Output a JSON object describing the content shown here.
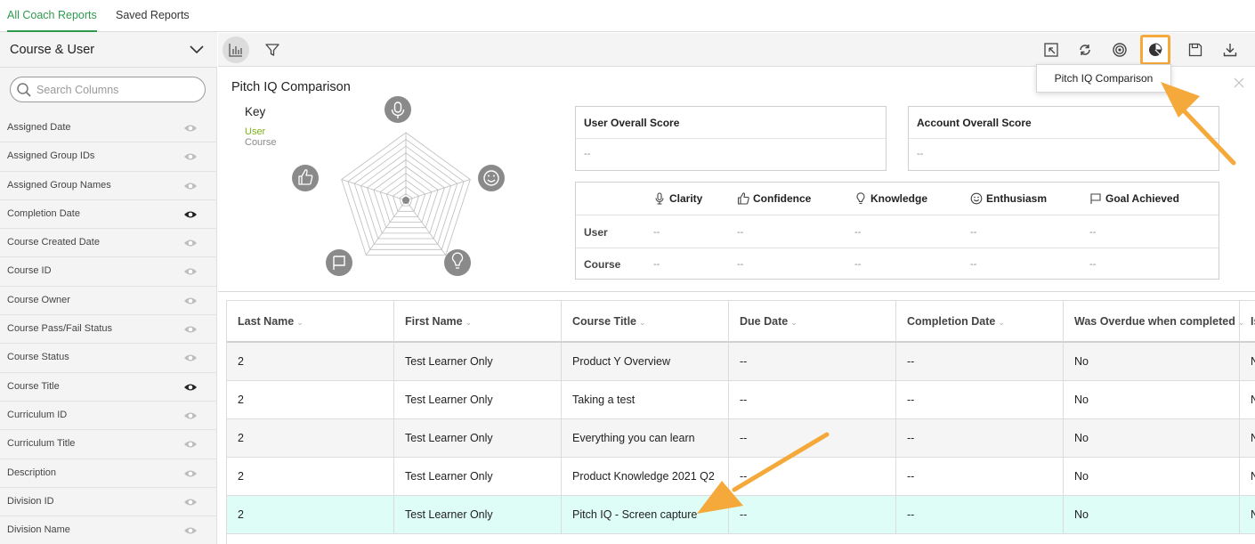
{
  "tabs": [
    {
      "label": "All Coach Reports",
      "active": true
    },
    {
      "label": "Saved Reports",
      "active": false
    }
  ],
  "sidebar": {
    "title": "Course & User",
    "search_placeholder": "Search Columns",
    "columns": [
      {
        "label": "Assigned Date",
        "visible": false
      },
      {
        "label": "Assigned Group IDs",
        "visible": false
      },
      {
        "label": "Assigned Group Names",
        "visible": false
      },
      {
        "label": "Completion Date",
        "visible": true
      },
      {
        "label": "Course Created Date",
        "visible": false
      },
      {
        "label": "Course ID",
        "visible": false
      },
      {
        "label": "Course Owner",
        "visible": false
      },
      {
        "label": "Course Pass/Fail Status",
        "visible": false
      },
      {
        "label": "Course Status",
        "visible": false
      },
      {
        "label": "Course Title",
        "visible": true
      },
      {
        "label": "Curriculum ID",
        "visible": false
      },
      {
        "label": "Curriculum Title",
        "visible": false
      },
      {
        "label": "Description",
        "visible": false
      },
      {
        "label": "Division ID",
        "visible": false
      },
      {
        "label": "Division Name",
        "visible": false
      }
    ]
  },
  "toolbar": {
    "tooltip": "Pitch IQ Comparison"
  },
  "pitch": {
    "title": "Pitch IQ Comparison",
    "key_title": "Key",
    "key_user": "User",
    "key_course": "Course",
    "user_overall_label": "User Overall Score",
    "user_overall_value": "--",
    "account_overall_label": "Account Overall Score",
    "account_overall_value": "--",
    "metrics": [
      "Clarity",
      "Confidence",
      "Knowledge",
      "Enthusiasm",
      "Goal Achieved"
    ],
    "rows": [
      {
        "label": "User",
        "values": [
          "--",
          "--",
          "--",
          "--",
          "--"
        ]
      },
      {
        "label": "Course",
        "values": [
          "--",
          "--",
          "--",
          "--",
          "--"
        ]
      }
    ]
  },
  "table": {
    "headers": [
      "Last Name",
      "First Name",
      "Course Title",
      "Due Date",
      "Completion Date",
      "Was Overdue when completed",
      "Is"
    ],
    "rows": [
      [
        "2",
        "Test Learner Only",
        "Product Y Overview",
        "--",
        "--",
        "No",
        "N"
      ],
      [
        "2",
        "Test Learner Only",
        "Taking a test",
        "--",
        "--",
        "No",
        "N"
      ],
      [
        "2",
        "Test Learner Only",
        "Everything you can learn",
        "--",
        "--",
        "No",
        "N"
      ],
      [
        "2",
        "Test Learner Only",
        "Product Knowledge 2021 Q2",
        "--",
        "--",
        "No",
        "N"
      ],
      [
        "2",
        "Test Learner Only",
        "Pitch IQ - Screen capture",
        "--",
        "--",
        "No",
        "N"
      ]
    ],
    "highlighted_row": 4
  },
  "colors": {
    "accent_green": "#2f9a4e",
    "highlight_orange": "#f4a93a",
    "row_highlight": "#defdf6"
  }
}
